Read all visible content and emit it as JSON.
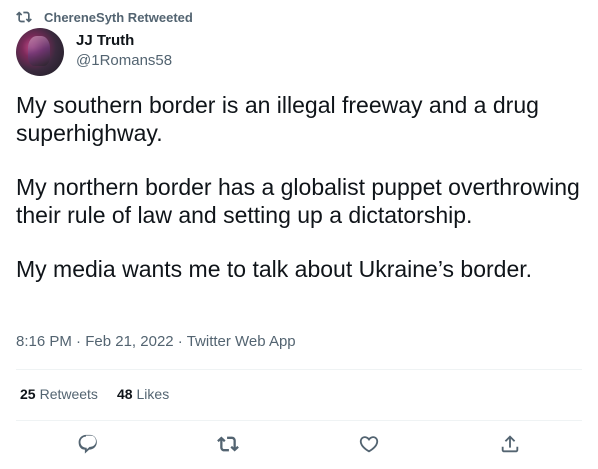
{
  "retweet": {
    "icon": "retweet-icon",
    "label": "ChereneSyth Retweeted"
  },
  "author": {
    "name": "JJ Truth",
    "handle": "@1Romans58"
  },
  "tweet": {
    "paragraphs": [
      "My southern border is an illegal freeway and a drug superhighway.",
      "My northern border has a globalist puppet overthrowing their rule of law and setting up a dictatorship.",
      "My media wants me to talk about Ukraine’s border."
    ],
    "time": "8:16 PM",
    "date": "Feb 21, 2022",
    "source": "Twitter Web App"
  },
  "stats": {
    "retweets_count": "25",
    "retweets_label": "Retweets",
    "likes_count": "48",
    "likes_label": "Likes"
  },
  "actions": [
    "reply-icon",
    "retweet-icon",
    "like-icon",
    "share-icon"
  ],
  "colors": {
    "text": "#0f1419",
    "secondary": "#536471",
    "divider": "#eff3f4"
  }
}
